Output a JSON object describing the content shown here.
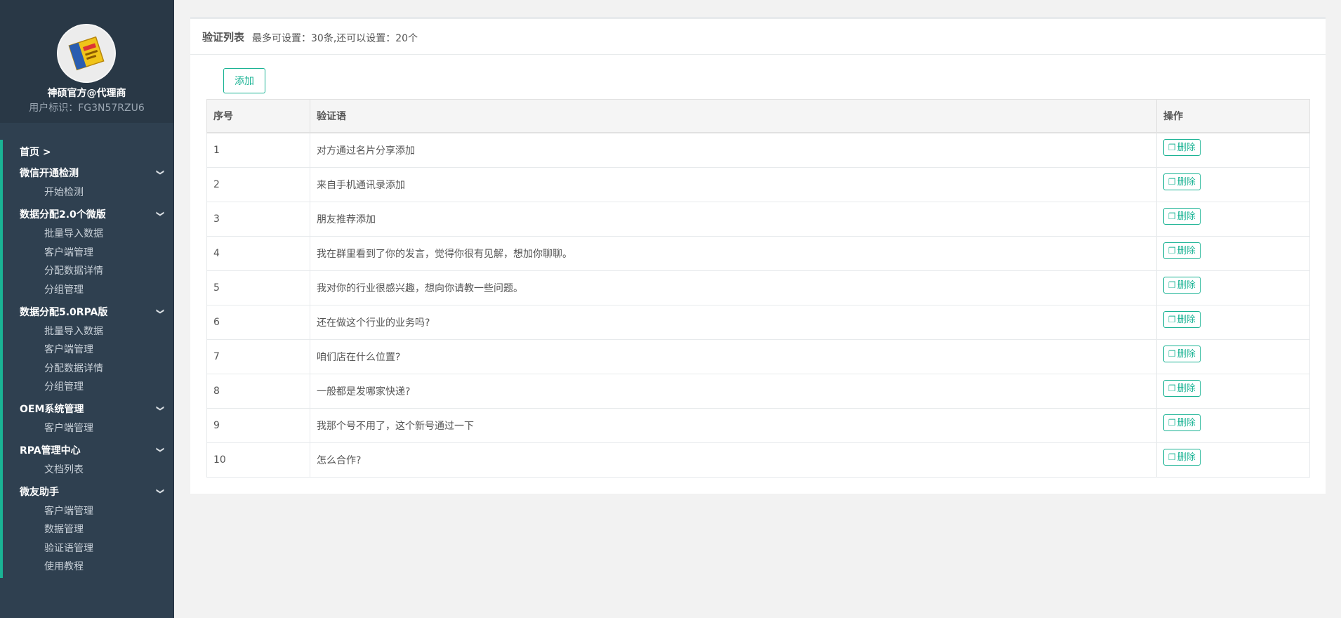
{
  "sidebar": {
    "user_name": "神硕官方@代理商",
    "user_id": "用户标识：FG3N57RZU6",
    "home": "首页 >",
    "groups": [
      {
        "label": "微信开通检测",
        "items": [
          "开始检测"
        ]
      },
      {
        "label": "数据分配2.0个微版",
        "items": [
          "批量导入数据",
          "客户端管理",
          "分配数据详情",
          "分组管理"
        ]
      },
      {
        "label": "数据分配5.0RPA版",
        "items": [
          "批量导入数据",
          "客户端管理",
          "分配数据详情",
          "分组管理"
        ]
      },
      {
        "label": "OEM系统管理",
        "items": [
          "客户端管理"
        ]
      },
      {
        "label": "RPA管理中心",
        "items": [
          "文档列表"
        ]
      },
      {
        "label": "微友助手",
        "items": [
          "客户端管理",
          "数据管理",
          "验证语管理",
          "使用教程"
        ]
      }
    ]
  },
  "panel": {
    "title": "验证列表",
    "subtitle": "最多可设置：30条,还可以设置：20个",
    "add_label": "添加"
  },
  "table": {
    "headers": [
      "序号",
      "验证语",
      "操作"
    ],
    "delete_label": "删除",
    "rows": [
      {
        "num": "1",
        "text": "对方通过名片分享添加"
      },
      {
        "num": "2",
        "text": "来自手机通讯录添加"
      },
      {
        "num": "3",
        "text": "朋友推荐添加"
      },
      {
        "num": "4",
        "text": "我在群里看到了你的发言，觉得你很有见解，想加你聊聊。"
      },
      {
        "num": "5",
        "text": "我对你的行业很感兴趣，想向你请教一些问题。"
      },
      {
        "num": "6",
        "text": "还在做这个行业的业务吗?"
      },
      {
        "num": "7",
        "text": "咱们店在什么位置?"
      },
      {
        "num": "8",
        "text": "一般都是发哪家快递?"
      },
      {
        "num": "9",
        "text": "我那个号不用了，这个新号通过一下"
      },
      {
        "num": "10",
        "text": "怎么合作?"
      }
    ]
  },
  "colors": {
    "accent": "#1ab394",
    "sidebar_bg": "#2f4050"
  }
}
